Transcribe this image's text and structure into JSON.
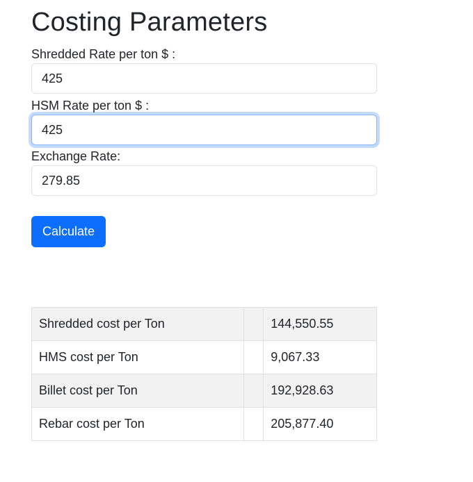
{
  "page": {
    "title": "Costing Parameters"
  },
  "form": {
    "shredded_rate": {
      "label": "Shredded Rate per ton $ :",
      "value": "425"
    },
    "hsm_rate": {
      "label": "HSM Rate per ton $ :",
      "value": "425"
    },
    "exchange_rate": {
      "label": "Exchange Rate:",
      "value": "279.85"
    },
    "calculate_label": "Calculate"
  },
  "results": {
    "rows": [
      {
        "label": "Shredded cost per Ton",
        "value": "144,550.55"
      },
      {
        "label": "HMS cost per Ton",
        "value": "9,067.33"
      },
      {
        "label": "Billet cost per Ton",
        "value": "192,928.63"
      },
      {
        "label": "Rebar cost per Ton",
        "value": "205,877.40"
      }
    ]
  },
  "colors": {
    "primary": "#0d6efd",
    "focus_ring": "#86b7fe",
    "border": "#dee2e6",
    "stripe": "#f2f2f2"
  }
}
